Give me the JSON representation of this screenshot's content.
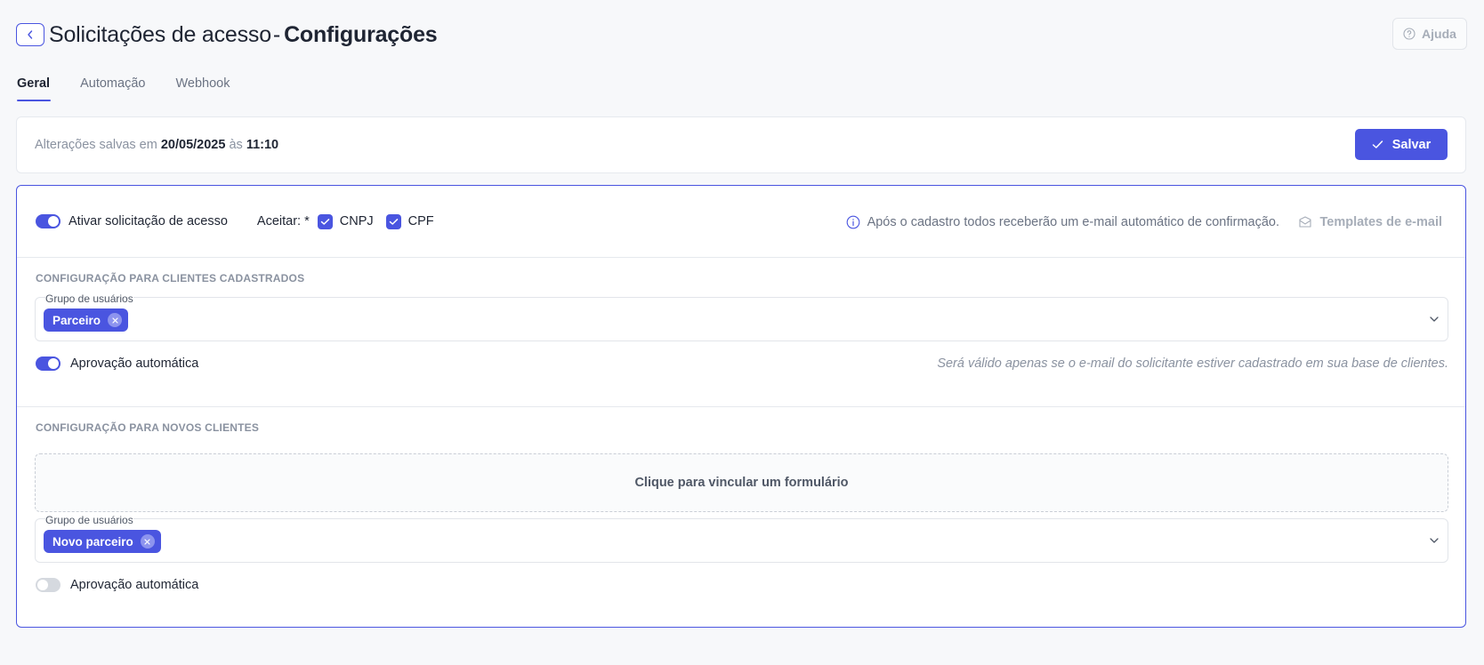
{
  "header": {
    "title_main": "Solicitações de acesso",
    "title_sep": "-",
    "title_bold": "Configurações",
    "help_label": "Ajuda"
  },
  "tabs": [
    {
      "label": "Geral",
      "active": true
    },
    {
      "label": "Automação",
      "active": false
    },
    {
      "label": "Webhook",
      "active": false
    }
  ],
  "save_bar": {
    "prefix": "Alterações salvas em",
    "date": "20/05/2025",
    "at": "às",
    "time": "11:10",
    "save_label": "Salvar"
  },
  "general": {
    "enable_label": "Ativar solicitação de acesso",
    "enable_on": true,
    "accept_label": "Aceitar: *",
    "cnpj_label": "CNPJ",
    "cpf_label": "CPF",
    "info_text": "Após o cadastro todos receberão um e-mail automático de confirmação.",
    "templates_label": "Templates de e-mail"
  },
  "registered": {
    "section_title": "CONFIGURAÇÃO PARA CLIENTES CADASTRADOS",
    "group_label": "Grupo de usuários",
    "group_chip": "Parceiro",
    "auto_label": "Aprovação automática",
    "auto_on": true,
    "auto_note": "Será válido apenas se o e-mail do solicitante estiver cadastrado em sua base de clientes."
  },
  "new_clients": {
    "section_title": "CONFIGURAÇÃO PARA NOVOS CLIENTES",
    "form_link": "Clique para vincular um formulário",
    "group_label": "Grupo de usuários",
    "group_chip": "Novo parceiro",
    "auto_label": "Aprovação automática",
    "auto_on": false
  },
  "colors": {
    "accent": "#4a55e0",
    "background": "#f7f8fa"
  }
}
